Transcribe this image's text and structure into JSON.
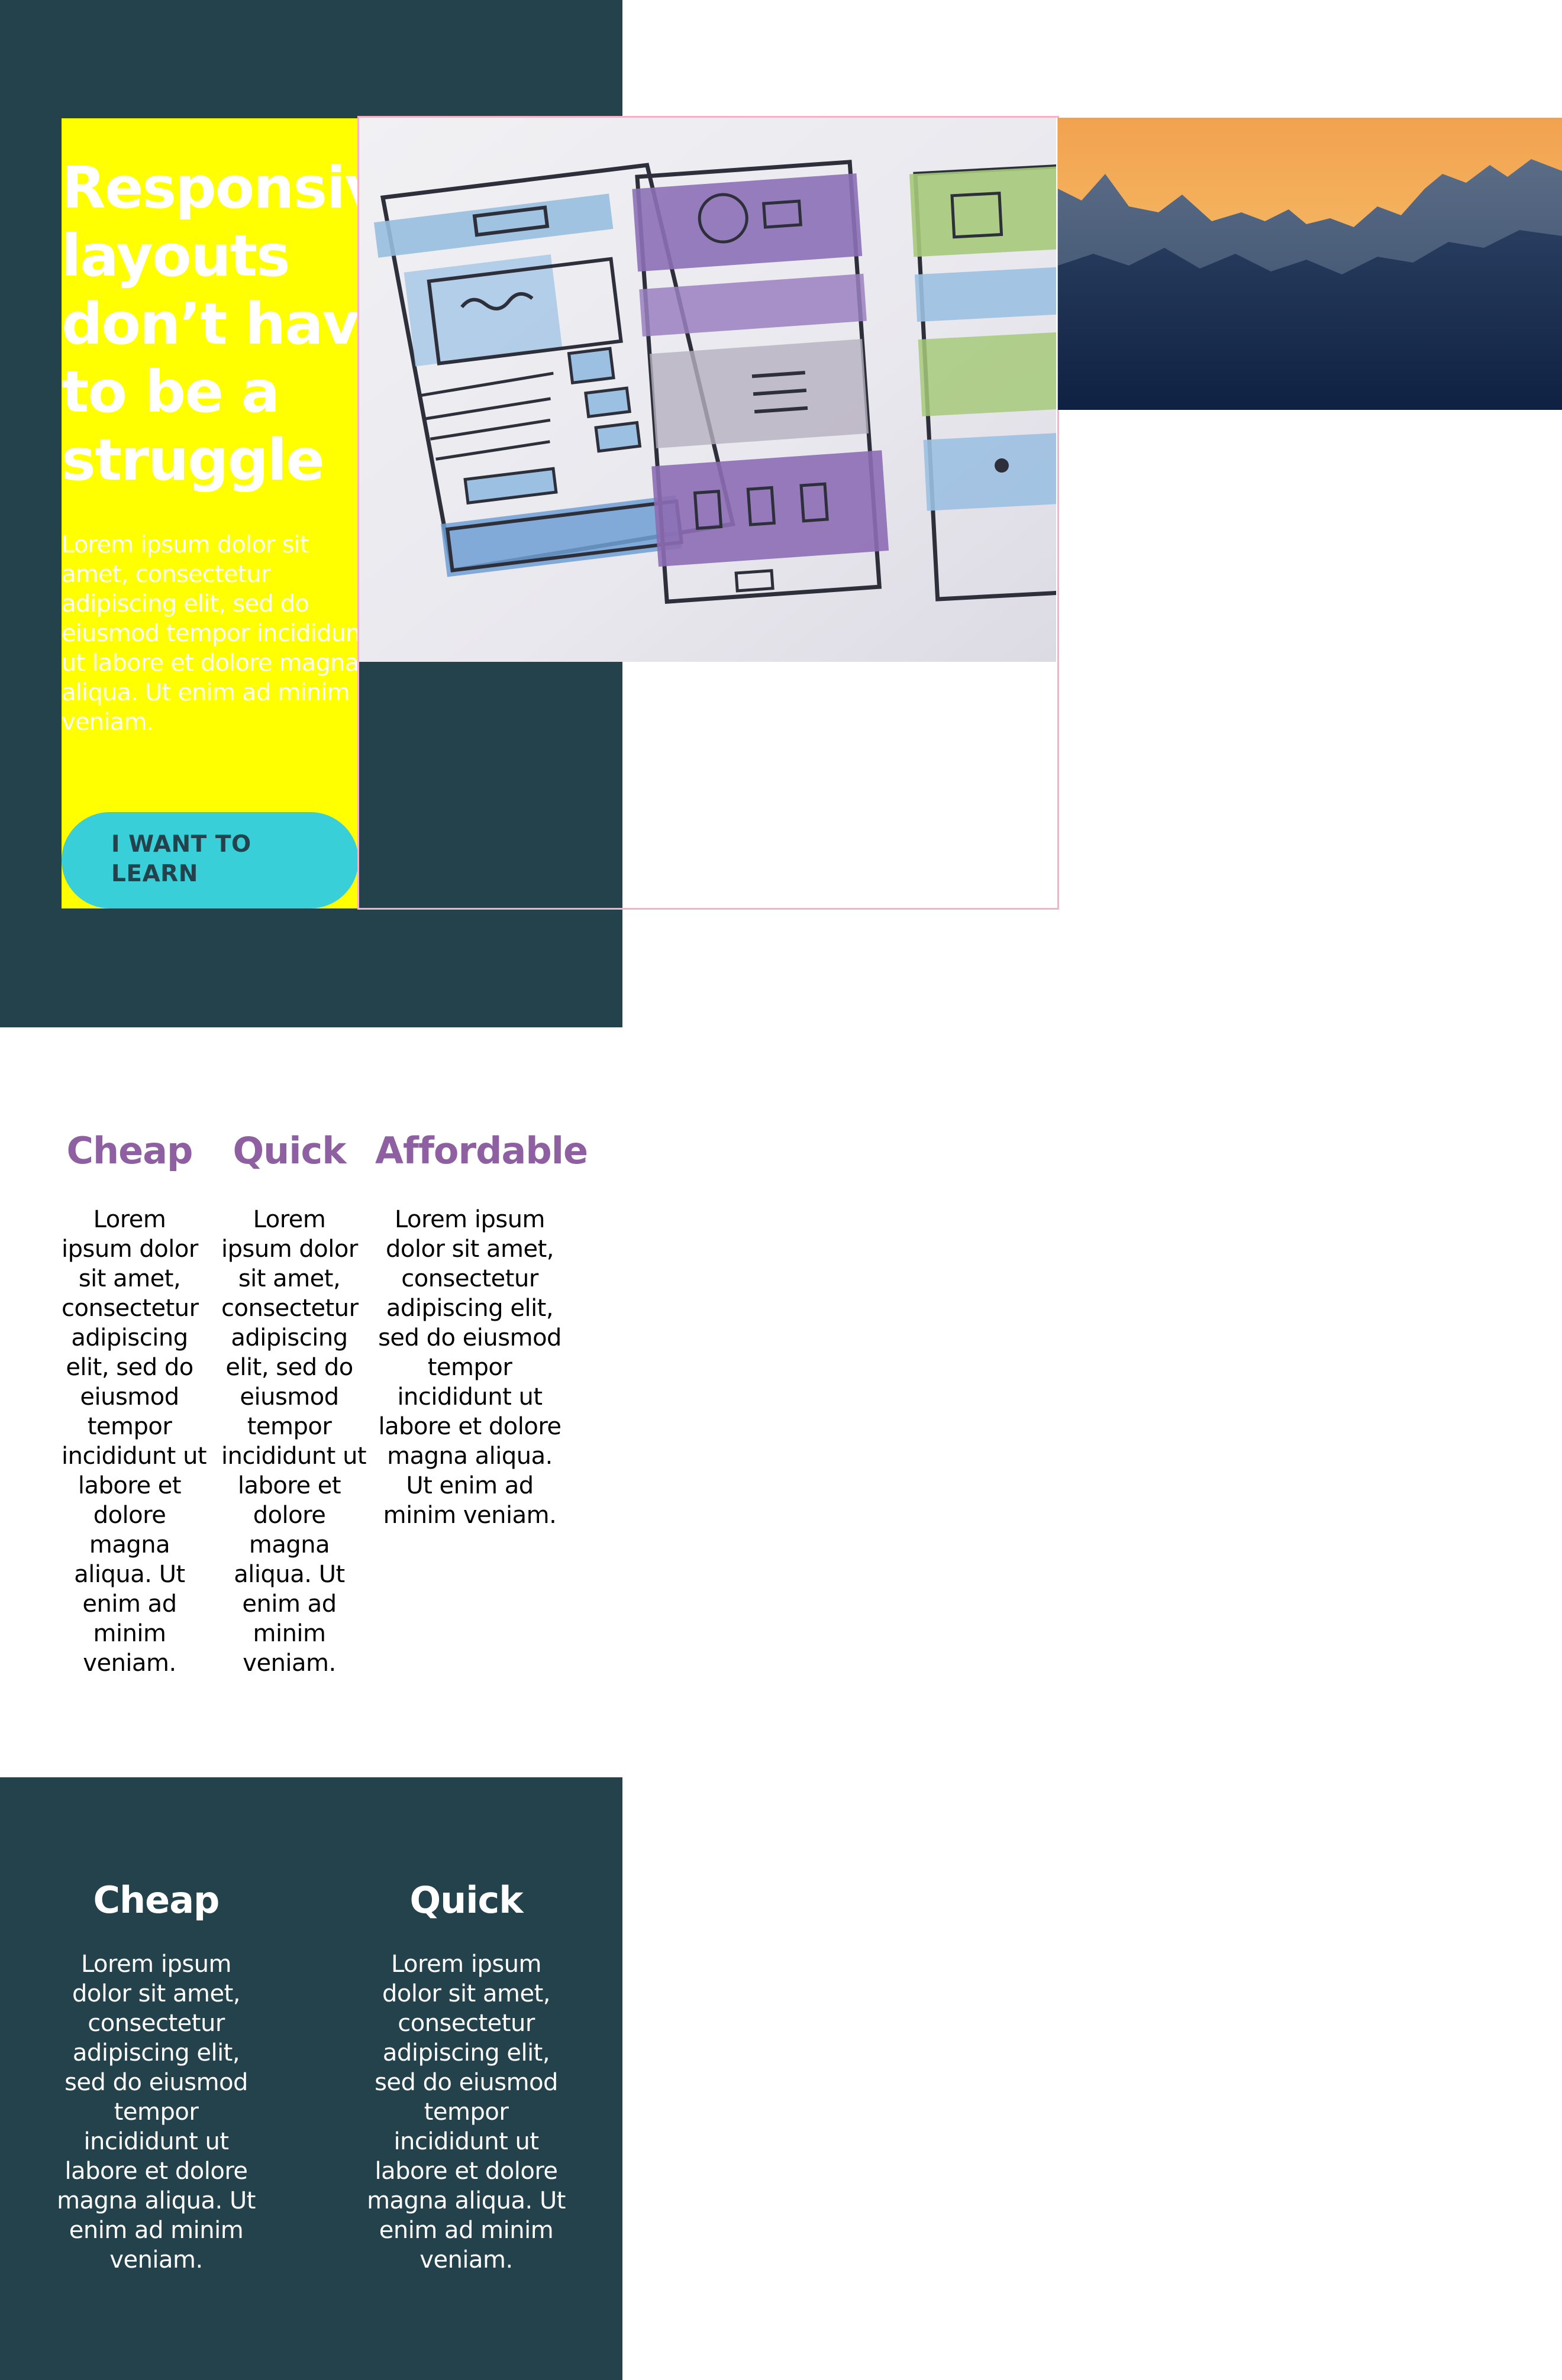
{
  "hero": {
    "title_lines": [
      "Responsive",
      "layouts",
      "don’t have",
      "to be a",
      "struggle"
    ],
    "body_lines": [
      "Lorem ipsum dolor sit",
      "amet, consectetur",
      "adipiscing elit, sed do",
      "eiusmod tempor incididunt",
      "ut labore et dolore magna",
      "aliqua. Ut enim ad minim",
      "veniam."
    ],
    "cta_lines": [
      "I WANT TO",
      "LEARN"
    ],
    "colors": {
      "background": "#23424b",
      "panel": "#ffff00",
      "button": "#38cfd9",
      "frame": "#f4b2c6"
    },
    "images": {
      "primary": "wireframe-sketch-image",
      "secondary": "mountain-sunset-image"
    }
  },
  "features": {
    "heading_color": "#8e60a1",
    "columns": [
      {
        "title": "Cheap",
        "body_lines": [
          "Lorem",
          "ipsum dolor",
          "sit amet,",
          "consectetur",
          "adipiscing",
          "elit, sed do",
          "eiusmod",
          "tempor",
          "incididunt ut",
          "labore et",
          "dolore",
          "magna",
          "aliqua. Ut",
          "enim ad",
          "minim",
          "veniam."
        ]
      },
      {
        "title": "Quick",
        "body_lines": [
          "Lorem",
          "ipsum dolor",
          "sit amet,",
          "consectetur",
          "adipiscing",
          "elit, sed do",
          "eiusmod",
          "tempor",
          "incididunt ut",
          "labore et",
          "dolore",
          "magna",
          "aliqua. Ut",
          "enim ad",
          "minim",
          "veniam."
        ]
      },
      {
        "title": "Affordable",
        "body_lines": [
          "Lorem ipsum",
          "dolor sit amet,",
          "consectetur",
          "adipiscing elit,",
          "sed do eiusmod",
          "tempor",
          "incididunt ut",
          "labore et dolore",
          "magna aliqua.",
          "Ut enim ad",
          "minim veniam."
        ]
      }
    ]
  },
  "footer_features": {
    "background": "#23424b",
    "columns": [
      {
        "title": "Cheap",
        "body_lines": [
          "Lorem ipsum",
          "dolor sit amet,",
          "consectetur",
          "adipiscing elit,",
          "sed do eiusmod",
          "tempor",
          "incididunt ut",
          "labore et dolore",
          "magna aliqua. Ut",
          "enim ad minim",
          "veniam."
        ]
      },
      {
        "title": "Quick",
        "body_lines": [
          "Lorem ipsum",
          "dolor sit amet,",
          "consectetur",
          "adipiscing elit,",
          "sed do eiusmod",
          "tempor",
          "incididunt ut",
          "labore et dolore",
          "magna aliqua. Ut",
          "enim ad minim",
          "veniam."
        ]
      }
    ]
  }
}
